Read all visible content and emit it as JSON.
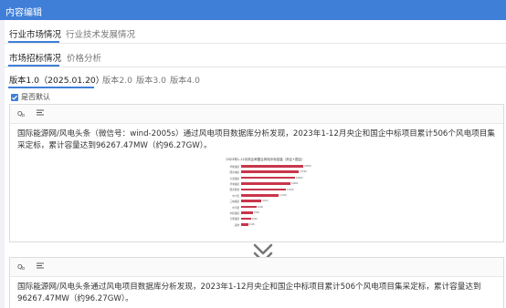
{
  "header": {
    "title": "内容编辑"
  },
  "tabs_primary": [
    {
      "label": "行业市场情况",
      "active": true
    },
    {
      "label": "行业技术发展情况",
      "active": false
    }
  ],
  "tabs_secondary": [
    {
      "label": "市场招标情况",
      "active": true
    },
    {
      "label": "价格分析",
      "active": false
    }
  ],
  "versions": [
    {
      "label": "版本1.0（2025.01.20）",
      "active": true
    },
    {
      "label": "版本2.0",
      "active": false
    },
    {
      "label": "版本3.0",
      "active": false
    },
    {
      "label": "版本4.0",
      "active": false
    }
  ],
  "default_checkbox": {
    "label": "是否默认",
    "checked": true
  },
  "toolbar_icons": [
    "format-icon",
    "align-icon"
  ],
  "editor_top": {
    "text": "国际能源网/风电头条（微信号：wind-2005s）通过风电项目数据库分析发现，2023年1-12月央企和国企中标项目累计506个风电项目集采定标，累计容量达到96267.47MW（约96.27GW）。"
  },
  "editor_bottom": {
    "text": "国际能源网/风电头条通过风电项目数据库分析发现，2023年1-12月央企和国企中标项目累计506个风电项目集采定标，累计容量达到96267.47MW（约96.27GW）。"
  },
  "chart_data": {
    "type": "bar",
    "title": "2023年1-12月央企和国企风电中标容量（央企+国企）",
    "categories": [
      "华能集团",
      "国家电投",
      "大唐集团",
      "华电集团",
      "国家能源",
      "中广核",
      "三峡集团",
      "中节能",
      "中核集团",
      "京能集团",
      "其他"
    ],
    "values": [
      18500,
      17200,
      16000,
      14600,
      13300,
      11200,
      6100,
      4600,
      3500,
      2900,
      2100
    ],
    "orientation": "horizontal",
    "color": "#c8364a"
  },
  "colors": {
    "accent": "#3f7fd8",
    "bar": "#c8364a"
  }
}
